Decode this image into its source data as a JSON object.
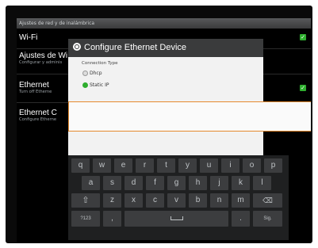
{
  "header": {
    "title": "Ajustes de red y de inalámbrica"
  },
  "settings": [
    {
      "title": "Wi-Fi",
      "subtitle": ""
    },
    {
      "title": "Ajustes de Wi",
      "subtitle": "Configurar y adminis"
    },
    {
      "title": "Ethernet",
      "subtitle": "Turn off Etherne"
    },
    {
      "title": "Ethernet C",
      "subtitle": "Configure Etherne"
    }
  ],
  "dialog": {
    "title": "Configure Ethernet Device",
    "connection_type_label": "Connection Type",
    "options": [
      {
        "label": "Dhcp",
        "selected": false
      },
      {
        "label": "Static IP",
        "selected": true
      }
    ],
    "ip_field": {
      "value": "",
      "placeholder": ""
    }
  },
  "keyboard": {
    "row1": [
      "q",
      "w",
      "e",
      "r",
      "t",
      "y",
      "u",
      "i",
      "o",
      "p"
    ],
    "row2": [
      "a",
      "s",
      "d",
      "f",
      "g",
      "h",
      "j",
      "k",
      "l"
    ],
    "row3": [
      "z",
      "x",
      "c",
      "v",
      "b",
      "n",
      "m"
    ],
    "bottom": {
      "symbols": "?123",
      "comma": ",",
      "period": ".",
      "next": "Sig."
    }
  },
  "colors": {
    "accent_green": "#2fae2f",
    "focus_orange": "#e58a2f"
  }
}
